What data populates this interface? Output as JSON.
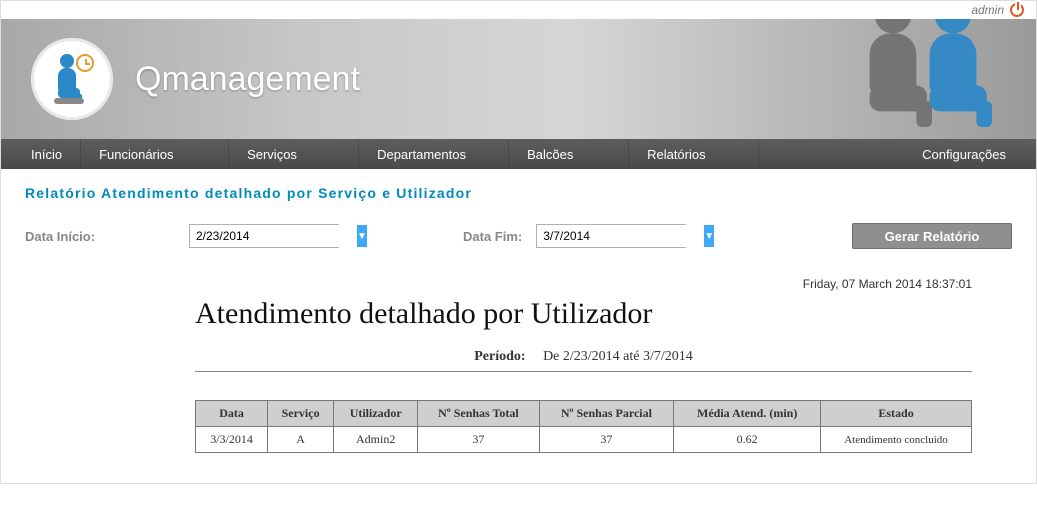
{
  "user": {
    "name": "admin"
  },
  "branding": {
    "title": "Qmanagement"
  },
  "nav": {
    "inicio": "Início",
    "funcionarios": "Funcionários",
    "servicos": "Serviços",
    "departamentos": "Departamentos",
    "balcoes": "Balcões",
    "relatorios": "Relatórios",
    "configuracoes": "Configurações"
  },
  "page": {
    "title": "Relatório Atendimento detalhado por Serviço e Utilizador"
  },
  "form": {
    "data_inicio_label": "Data Início:",
    "data_inicio_value": "2/23/2014",
    "data_fim_label": "Data Fim:",
    "data_fim_value": "3/7/2014",
    "submit_label": "Gerar Relatório"
  },
  "report": {
    "generated_at": "Friday, 07 March 2014 18:37:01",
    "heading": "Atendimento detalhado por Utilizador",
    "period_label": "Período:",
    "period_value": "De 2/23/2014 até 3/7/2014",
    "columns": {
      "data": "Data",
      "servico": "Serviço",
      "utilizador": "Utilizador",
      "senhas_total": "Nº Senhas Total",
      "senhas_parcial": "Nº Senhas Parcial",
      "media_atend": "Média Atend. (min)",
      "estado": "Estado"
    },
    "rows": [
      {
        "data": "3/3/2014",
        "servico": "A",
        "utilizador": "Admin2",
        "senhas_total": "37",
        "senhas_parcial": "37",
        "media_atend": "0.62",
        "estado": "Atendimento concluido"
      }
    ]
  }
}
